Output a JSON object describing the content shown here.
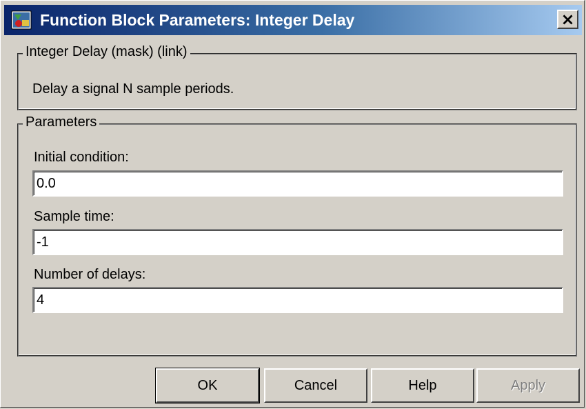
{
  "window": {
    "title": "Function Block Parameters: Integer Delay",
    "close_glyph": "×",
    "icon": "simulink-block-icon"
  },
  "description_group": {
    "legend": "Integer Delay (mask) (link)",
    "text": "Delay a signal N sample periods."
  },
  "parameters_group": {
    "legend": "Parameters",
    "fields": [
      {
        "label": "Initial condition:",
        "value": "0.0"
      },
      {
        "label": "Sample time:",
        "value": "-1"
      },
      {
        "label": "Number of delays:",
        "value": "4"
      }
    ]
  },
  "buttons": {
    "ok": "OK",
    "cancel": "Cancel",
    "help": "Help",
    "apply": "Apply"
  },
  "colors": {
    "titlebar_start": "#0a246a",
    "titlebar_end": "#a6caf0",
    "face": "#d4d0c8"
  }
}
